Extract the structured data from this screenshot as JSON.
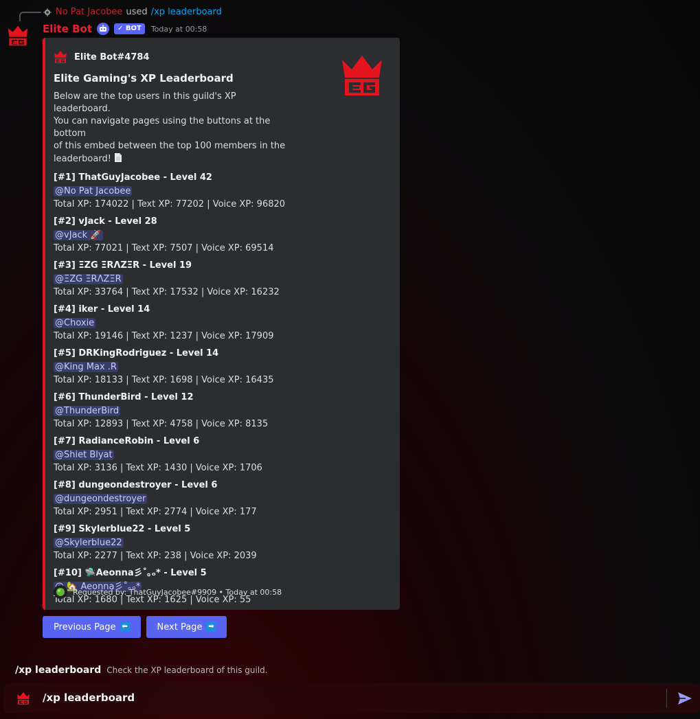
{
  "colors": {
    "brand_red": "#e3141d",
    "blurple": "#5865f2",
    "embed_bg": "#2b2d31"
  },
  "reply": {
    "user": "No Pat Jacobee",
    "used": "used",
    "command": "/xp leaderboard"
  },
  "message": {
    "author": "Elite Bot",
    "badge": "✓ BOT",
    "timestamp": "Today at 00:58"
  },
  "embed": {
    "author": "Elite Bot#4784",
    "title": "Elite Gaming's XP Leaderboard",
    "description_lines": [
      "Below are the top users in this guild's XP leaderboard.",
      "You can navigate pages using the buttons at the bottom",
      "of this embed between the top 100 members in the",
      "leaderboard!"
    ],
    "entries": [
      {
        "title": "[#1] ThatGuyJacobee - Level 42",
        "mention": "@No Pat Jacobee",
        "stats": "Total XP: 174022 | Text XP: 77202 | Voice XP: 96820"
      },
      {
        "title": "[#2] vJack - Level 28",
        "mention": "@vJack 🚀",
        "stats": "Total XP: 77021 | Text XP: 7507 | Voice XP: 69514"
      },
      {
        "title": "[#3] ΞZG ΞRΛZΞR - Level 19",
        "mention": "@ΞZG ΞRΛZΞR",
        "stats": "Total XP: 33764 | Text XP: 17532 | Voice XP: 16232"
      },
      {
        "title": "[#4] iker - Level 14",
        "mention": "@Choxie",
        "stats": "Total XP: 19146 | Text XP: 1237 | Voice XP: 17909"
      },
      {
        "title": "[#5] DRKingRodriguez - Level 14",
        "mention": "@King Max .R",
        "stats": "Total XP: 18133 | Text XP: 1698 | Voice XP: 16435"
      },
      {
        "title": "[#6] ThunderBird - Level 12",
        "mention": "@ThunderBird",
        "stats": "Total XP: 12893 | Text XP: 4758 | Voice XP: 8135"
      },
      {
        "title": "[#7] RadianceRobin - Level 6",
        "mention": "@Shiet Blyat",
        "stats": "Total XP: 3136 | Text XP: 1430 | Voice XP: 1706"
      },
      {
        "title": "[#8] dungeondestroyer - Level 6",
        "mention": "@dungeondestroyer",
        "stats": "Total XP: 2951 | Text XP: 2774 | Voice XP: 177"
      },
      {
        "title": "[#9] Skylerblue22 - Level 5",
        "mention": "@Skylerblue22",
        "stats": "Total XP: 2277 | Text XP: 238 | Voice XP: 2039"
      },
      {
        "title": "[#10] 🛸Aeonna彡˚｡ₒ* - Level 5",
        "mention": "@ 🏡 Aeonna彡˚｡ₒ*",
        "stats": "Total XP: 1680 | Text XP: 1625 | Voice XP: 55"
      }
    ],
    "footer": "Requested by: ThatGuyJacobee#9909 • Today at 00:58"
  },
  "buttons": {
    "previous": "Previous Page",
    "next": "Next Page"
  },
  "command_hint": {
    "name": "/xp leaderboard",
    "description": "Check the XP leaderboard of this guild."
  },
  "composer": {
    "text": "/xp leaderboard"
  },
  "icons": [
    "crown-logo-icon",
    "bot-icon",
    "document-icon",
    "arrow-left-icon",
    "arrow-right-icon",
    "send-icon"
  ]
}
